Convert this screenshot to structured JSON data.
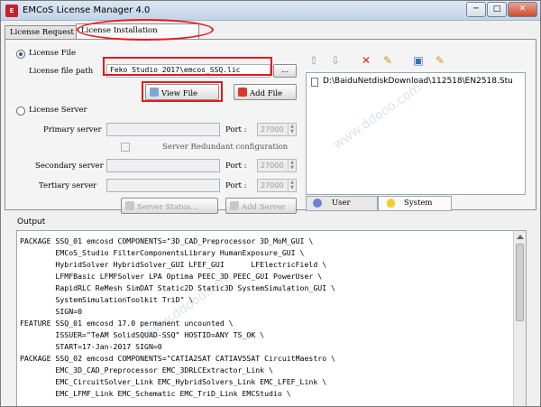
{
  "window": {
    "title": "EMCoS License Manager 4.0",
    "icon_text": "E",
    "controls": {
      "minimize": "─",
      "maximize": "□",
      "close": "✕"
    }
  },
  "tabs": [
    {
      "label": "License Request"
    },
    {
      "label": "License Installation"
    }
  ],
  "license_file": {
    "radio_label": "License File",
    "path_label": "License file path",
    "path_value": "Feko Studio 2017\\emcos_SSQ.lic",
    "browse_label": "...",
    "view_button": "View File",
    "add_button": "Add File"
  },
  "license_server": {
    "radio_label": "License Server",
    "primary_label": "Primary server",
    "secondary_label": "Secondary server",
    "tertiary_label": "Tertiary server",
    "port_label": "Port :",
    "port_value": "27000",
    "redundant_label": "Server Redundant configuration",
    "status_button": "Server Status...",
    "add_server_button": "Add Server"
  },
  "toolbar": {
    "icons": [
      "arrow-up-icon",
      "arrow-down-icon",
      "delete-icon",
      "clean-icon",
      "view-icon",
      "clean-all-icon"
    ]
  },
  "file_list": {
    "items": [
      "D:\\BaiduNetdiskDownload\\112518\\EN2518.Stu"
    ]
  },
  "subtabs": [
    {
      "label": "User"
    },
    {
      "label": "System"
    }
  ],
  "output": {
    "label": "Output",
    "lines": [
      "PACKAGE SSQ_01 emcosd COMPONENTS=\"3D_CAD_Preprocessor 3D_MoM_GUI \\",
      "        EMCoS_Studio FilterComponentsLibrary HumanExposure_GUI \\",
      "        HybridSolver HybridSolver_GUI LFEF_GUI      LFElectricField \\",
      "        LFMFBasic LFMFSolver LPA Optima PEEC_3D PEEC_GUI PowerUser \\",
      "        RapidRLC ReMesh SimDAT Static2D Static3D SystemSimulation_GUI \\",
      "        SystemSimulationToolkit TriD\" \\",
      "        SIGN=0",
      "FEATURE SSQ_01 emcosd 17.0 permanent uncounted \\",
      "        ISSUER=\"TeAM SolidSQUAD-SSQ\" HOSTID=ANY TS_OK \\",
      "        START=17-Jan-2017 SIGN=0",
      "PACKAGE SSQ_02 emcosd COMPONENTS=\"CATIA2SAT CATIAV5SAT CircuitMaestro \\",
      "        EMC_3D_CAD_Preprocessor EMC_3DRLCExtractor_Link \\",
      "        EMC_CircuitSolver_Link EMC_HybridSolvers_Link EMC_LFEF_Link \\",
      "        EMC_LFMF_Link EMC_Schematic EMC_TriD_Link EMCStudio \\"
    ]
  },
  "colors": {
    "highlight": "#e8181d",
    "accent": "#2257b0"
  }
}
